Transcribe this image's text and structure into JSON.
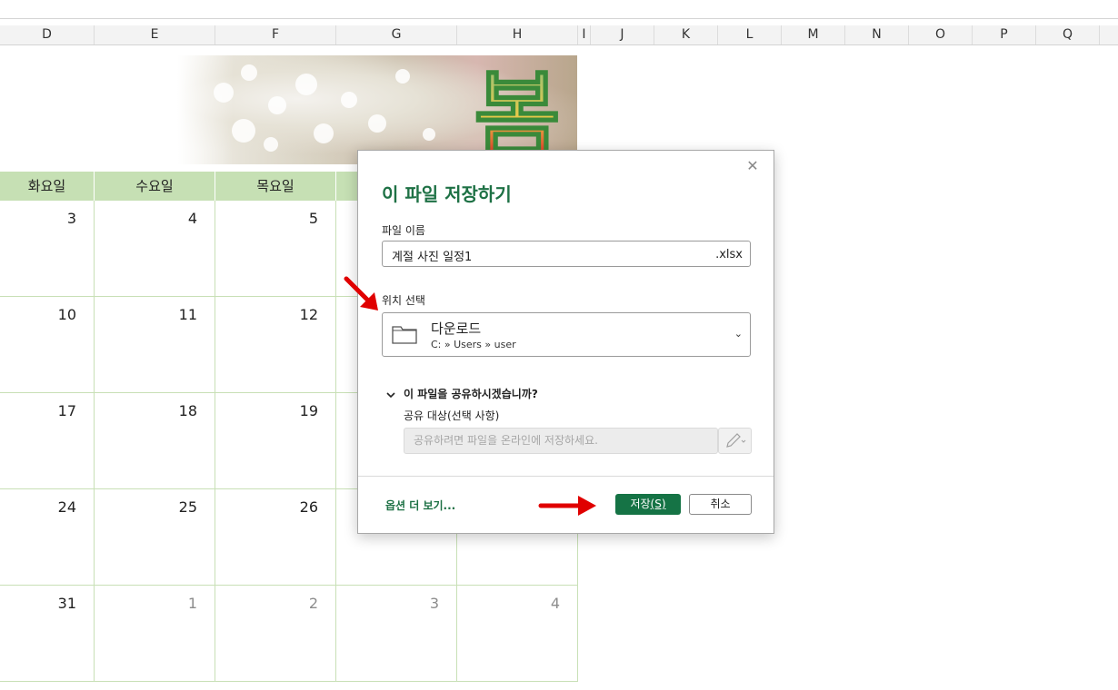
{
  "column_headers": [
    "D",
    "E",
    "F",
    "G",
    "H",
    "I",
    "J",
    "K",
    "L",
    "M",
    "N",
    "O",
    "P",
    "Q"
  ],
  "banner_char": "봄",
  "calendar": {
    "day_headers": [
      "화요일",
      "수요일",
      "목요일"
    ],
    "rows": [
      [
        {
          "v": "3",
          "dim": false
        },
        {
          "v": "4",
          "dim": false
        },
        {
          "v": "5",
          "dim": false
        },
        {
          "v": "",
          "dim": false
        },
        {
          "v": "",
          "dim": false
        }
      ],
      [
        {
          "v": "10",
          "dim": false
        },
        {
          "v": "11",
          "dim": false
        },
        {
          "v": "12",
          "dim": false
        },
        {
          "v": "",
          "dim": false
        },
        {
          "v": "",
          "dim": false
        }
      ],
      [
        {
          "v": "17",
          "dim": false
        },
        {
          "v": "18",
          "dim": false
        },
        {
          "v": "19",
          "dim": false
        },
        {
          "v": "",
          "dim": false
        },
        {
          "v": "",
          "dim": false
        }
      ],
      [
        {
          "v": "24",
          "dim": false
        },
        {
          "v": "25",
          "dim": false
        },
        {
          "v": "26",
          "dim": false
        },
        {
          "v": "",
          "dim": false
        },
        {
          "v": "",
          "dim": false
        }
      ],
      [
        {
          "v": "31",
          "dim": false
        },
        {
          "v": "1",
          "dim": true
        },
        {
          "v": "2",
          "dim": true
        },
        {
          "v": "3",
          "dim": true
        },
        {
          "v": "4",
          "dim": true
        }
      ]
    ]
  },
  "dialog": {
    "title": "이 파일 저장하기",
    "close_icon": "close-icon",
    "filename_label": "파일 이름",
    "filename_value": "계절 사진 일정1",
    "filename_ext": ".xlsx",
    "location_label": "위치 선택",
    "location_name": "다운로드",
    "location_path": "C: » Users » user",
    "share_toggle": "이 파일을 공유하시겠습니까?",
    "share_label": "공유 대상(선택 사항)",
    "share_placeholder": "공유하려면 파일을 온라인에 저장하세요.",
    "more_options": "옵션 더 보기...",
    "save_label": "저장",
    "save_shortcut": "(S)",
    "cancel_label": "취소"
  },
  "colors": {
    "accent_green": "#1e7145",
    "save_button": "#157345",
    "day_header_bg": "#c6e0b4",
    "annotation_arrow": "#e00000"
  }
}
